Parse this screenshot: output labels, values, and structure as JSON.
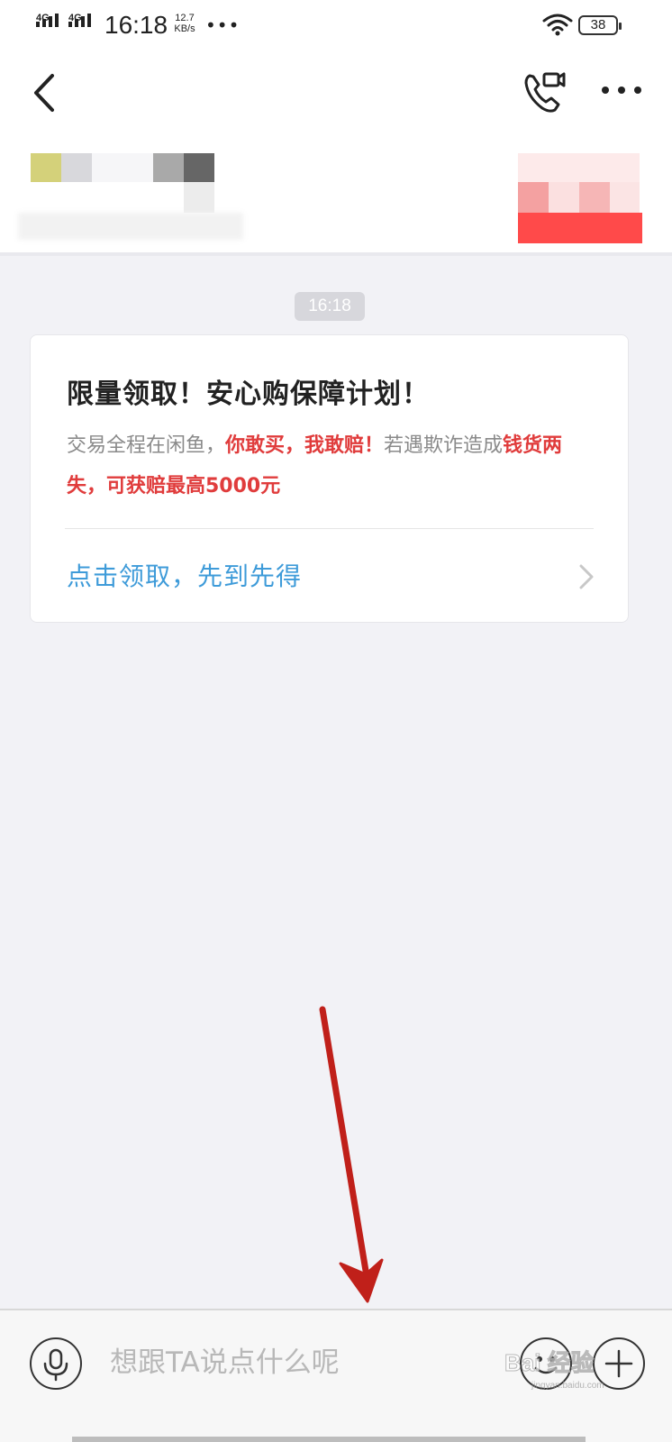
{
  "status_bar": {
    "network_1": "4G",
    "network_2": "4G",
    "time": "16:18",
    "speed_value": "12.7",
    "speed_unit": "KB/s",
    "overflow": "•••",
    "battery": "38"
  },
  "header": {
    "title": "",
    "back_icon": "chevron-left-icon",
    "call_icon": "phone-video-icon",
    "more_icon": "more-horizontal-icon"
  },
  "chat": {
    "timestamp": "16:18",
    "card": {
      "title": "限量领取！安心购保障计划！",
      "body_part1": "交易全程在闲鱼，",
      "body_part2_red": "你敢买，我敢赔！",
      "body_part3": "若遇欺诈造成",
      "body_part4_red": "钱货两失，可获赔最高5000元",
      "link": "点击领取，先到先得",
      "colors": {
        "highlight": "#e03c3c",
        "link": "#3e9bd9"
      }
    }
  },
  "input_bar": {
    "placeholder": "想跟TA说点什么呢",
    "voice_icon": "microphone-icon",
    "emoji_icon": "smiley-icon",
    "plus_icon": "plus-icon",
    "watermark": "Bai 经验",
    "watermark_sub": "jingyan.baidu.com"
  }
}
